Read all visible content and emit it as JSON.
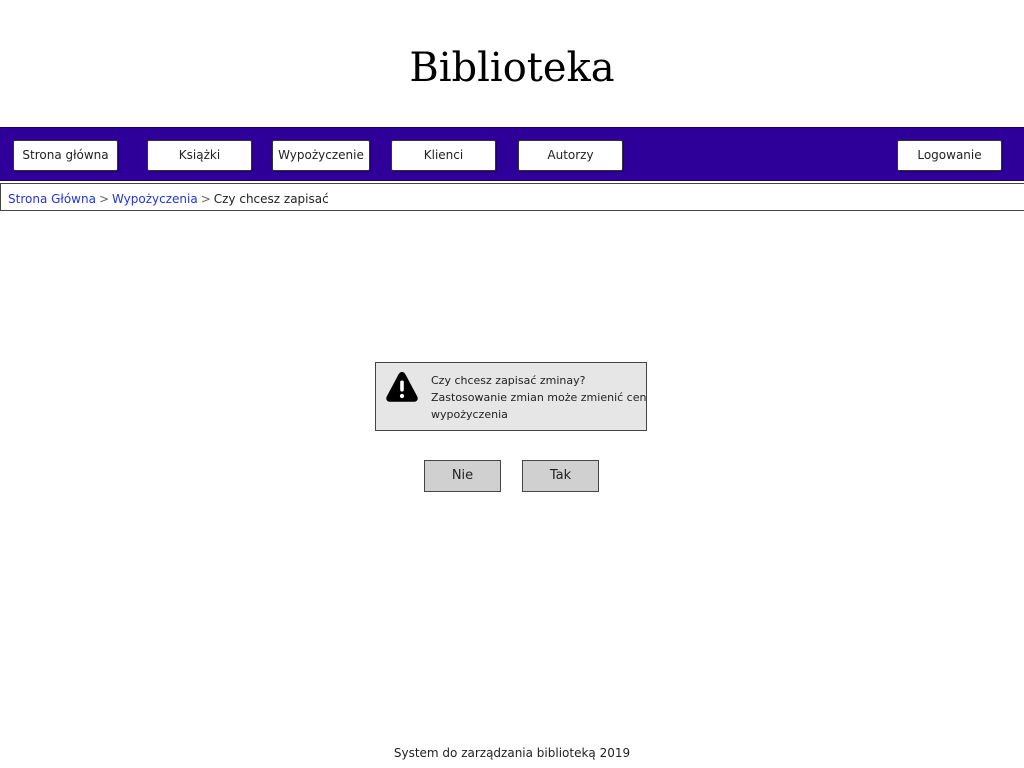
{
  "header": {
    "title": "Biblioteka"
  },
  "nav": {
    "items": [
      {
        "label": "Strona główna"
      },
      {
        "label": "Książki"
      },
      {
        "label": "Wypożyczenie"
      },
      {
        "label": "Klienci"
      },
      {
        "label": "Autorzy"
      }
    ],
    "login_label": "Logowanie"
  },
  "breadcrumb": {
    "items": [
      {
        "label": "Strona Główna"
      },
      {
        "label": "Wypożyczenia"
      }
    ],
    "separator": ">",
    "current": "Czy chcesz zapisać"
  },
  "dialog": {
    "icon": "warning-icon",
    "lines": [
      "Czy chcesz zapisać zminay?",
      "Zastosowanie zmian może zmienić cenę",
      "wypożyczenia"
    ],
    "no_label": "Nie",
    "yes_label": "Tak"
  },
  "footer": {
    "text": "System do zarządzania biblioteką 2019"
  },
  "colors": {
    "navbar": "#2f0099",
    "link": "#2233dd",
    "alert_bg": "#e6e6e6",
    "button_bg": "#d0d0d0"
  }
}
